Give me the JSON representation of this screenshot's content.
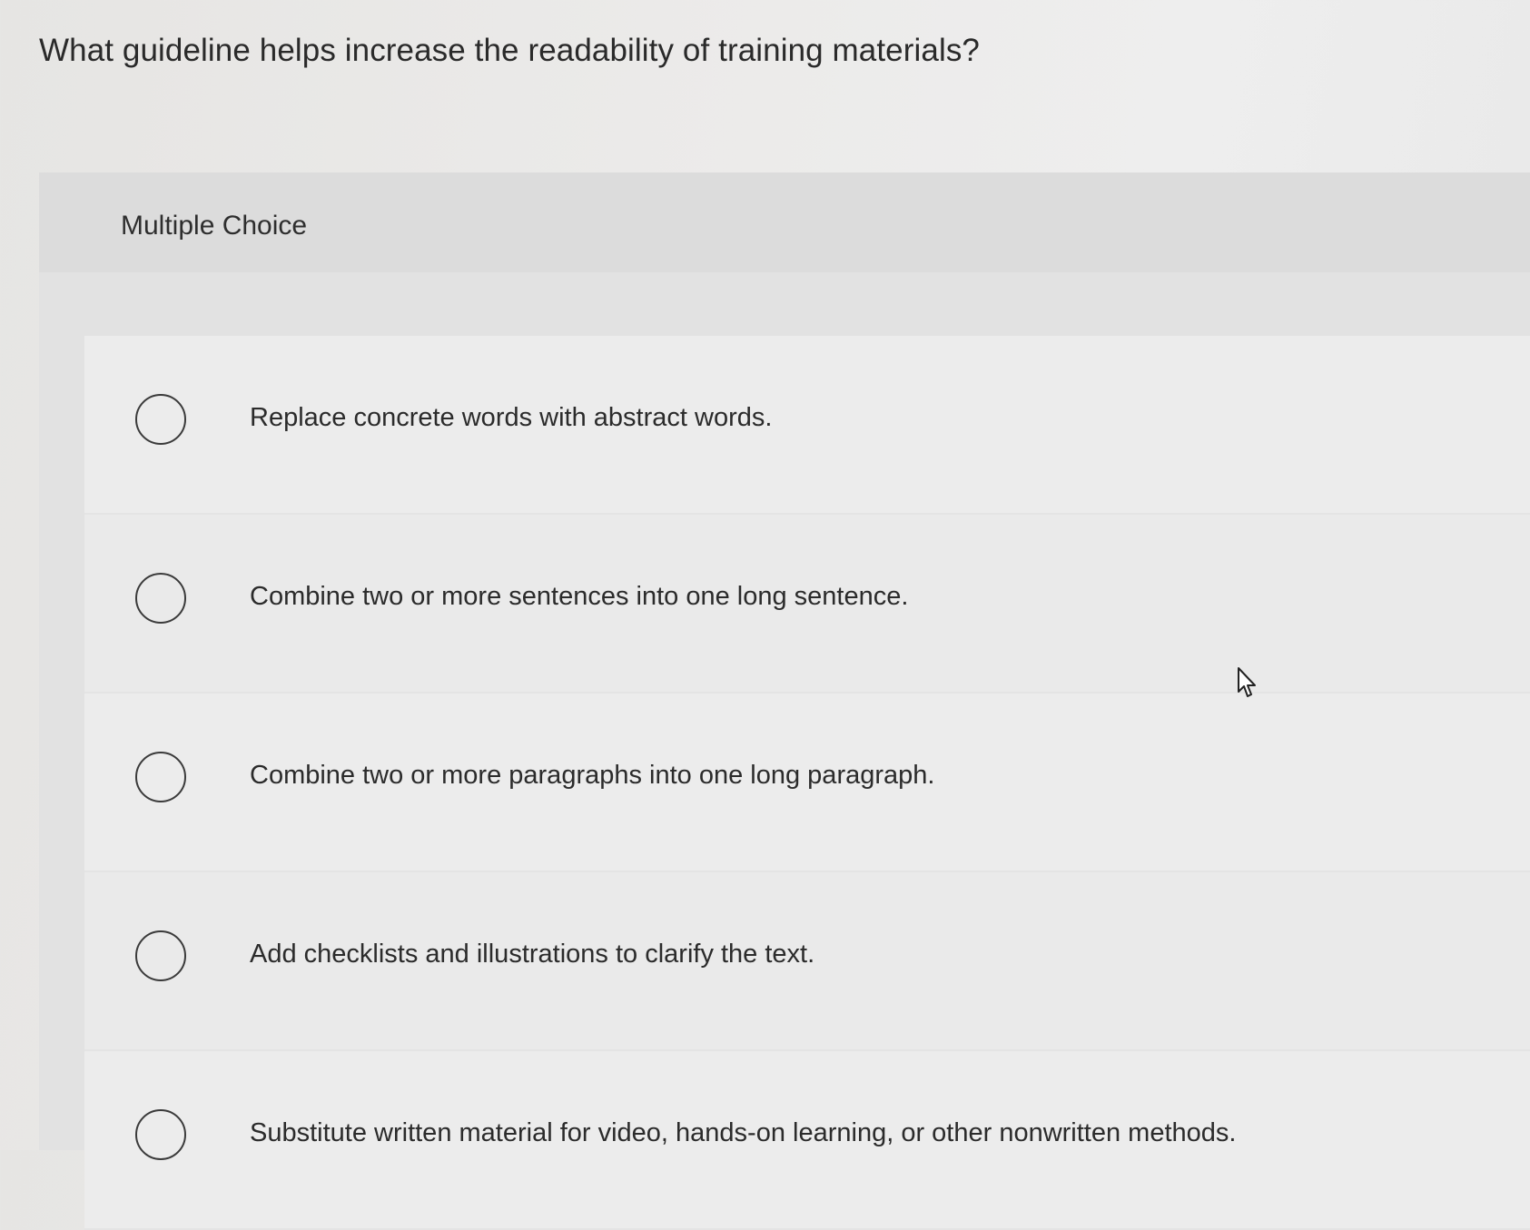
{
  "question": {
    "text": "What guideline helps increase the readability of training materials?"
  },
  "panel": {
    "label": "Multiple Choice"
  },
  "choices": [
    {
      "text": "Replace concrete words with abstract words.",
      "selected": false
    },
    {
      "text": "Combine two or more sentences into one long sentence.",
      "selected": false
    },
    {
      "text": "Combine two or more paragraphs into one long paragraph.",
      "selected": false
    },
    {
      "text": "Add checklists and illustrations to clarify the text.",
      "selected": false
    },
    {
      "text": "Substitute written material for video, hands-on learning, or other nonwritten methods.",
      "selected": false
    }
  ],
  "cursor": {
    "icon": "mouse-pointer-icon"
  }
}
